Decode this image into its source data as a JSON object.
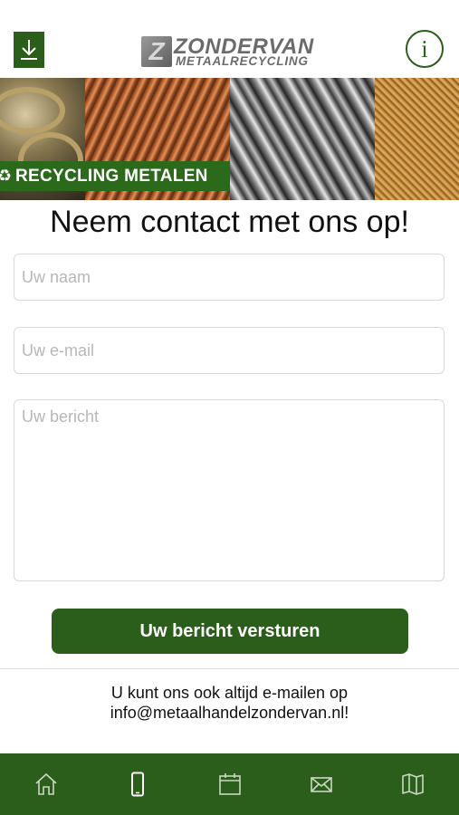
{
  "header": {
    "logo_title": "ZONDERVAN",
    "logo_subtitle": "METAALRECYCLING",
    "logo_mark": "Z",
    "info_label": "i"
  },
  "banner": {
    "label": "RECYCLING METALEN",
    "icon": "recycle-icon"
  },
  "page_title": "Neem contact met ons op!",
  "form": {
    "name_placeholder": "Uw naam",
    "email_placeholder": "Uw e-mail",
    "message_placeholder": "Uw bericht",
    "submit_label": "Uw bericht versturen"
  },
  "note": {
    "line1": "U kunt ons ook altijd e-mailen op",
    "line2": "info@metaalhandelzondervan.nl!"
  },
  "tabbar": {
    "items": [
      "home-icon",
      "phone-icon",
      "calendar-icon",
      "mail-icon",
      "map-icon"
    ]
  },
  "colors": {
    "brand_green": "#2b5e1a",
    "status_yellow": "#f5c400"
  }
}
